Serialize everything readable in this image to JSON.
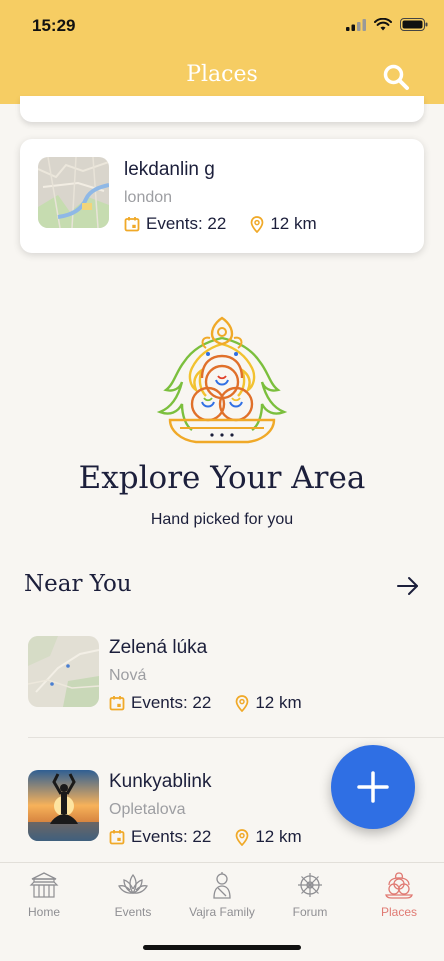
{
  "status": {
    "time": "15:29"
  },
  "header": {
    "title": "Places"
  },
  "featured_place": {
    "name": "lekdanlin g",
    "city": "london",
    "events": "Events: 22",
    "distance": "12 km"
  },
  "hero": {
    "title": "Explore Your Area",
    "subtitle": "Hand picked for you"
  },
  "near_you": {
    "heading": "Near You",
    "items": [
      {
        "name": "Zelená lúka",
        "street": "Nová",
        "events": "Events: 22",
        "distance": "12 km"
      },
      {
        "name": "Kunkyablink",
        "street": "Opletalova",
        "events": "Events: 22",
        "distance": "12 km"
      }
    ]
  },
  "tabs": [
    {
      "label": "Home",
      "icon": "temple-icon"
    },
    {
      "label": "Events",
      "icon": "lotus-icon"
    },
    {
      "label": "Vajra Family",
      "icon": "monk-icon"
    },
    {
      "label": "Forum",
      "icon": "dharma-wheel-icon"
    },
    {
      "label": "Places",
      "icon": "places-icon",
      "active": true
    }
  ],
  "colors": {
    "header": "#f6cd63",
    "accent_orange": "#f0a928",
    "fab": "#2f6fe4",
    "active_tab": "#e07a73"
  }
}
